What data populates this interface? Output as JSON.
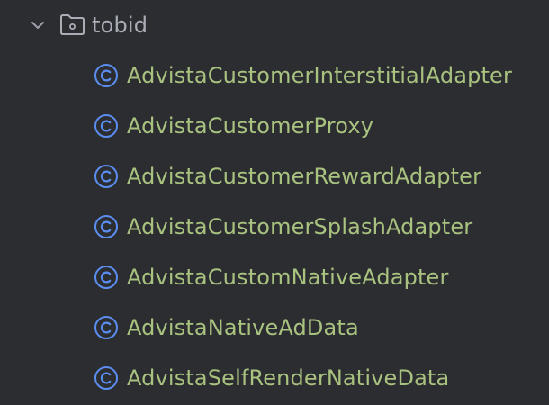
{
  "folder": {
    "name": "tobid",
    "expanded": true,
    "icon": "folder-icon",
    "chevron_icon": "chevron-down-icon"
  },
  "classes": [
    {
      "name": "AdvistaCustomerInterstitialAdapter",
      "icon": "class-icon"
    },
    {
      "name": "AdvistaCustomerProxy",
      "icon": "class-icon"
    },
    {
      "name": "AdvistaCustomerRewardAdapter",
      "icon": "class-icon"
    },
    {
      "name": "AdvistaCustomerSplashAdapter",
      "icon": "class-icon"
    },
    {
      "name": "AdvistaCustomNativeAdapter",
      "icon": "class-icon"
    },
    {
      "name": "AdvistaNativeAdData",
      "icon": "class-icon"
    },
    {
      "name": "AdvistaSelfRenderNativeData",
      "icon": "class-icon"
    }
  ],
  "colors": {
    "background": "#2b2d31",
    "folder_text": "#a9adb5",
    "class_text": "#a9c27f",
    "class_icon": "#5b8def"
  }
}
